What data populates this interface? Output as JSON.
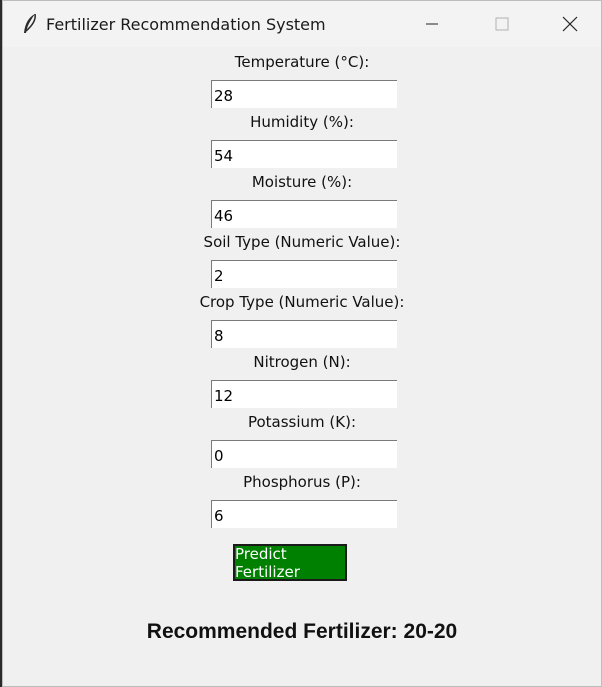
{
  "window": {
    "title": "Fertilizer Recommendation System",
    "app_icon": "feather-icon",
    "controls": [
      "minimize-icon",
      "maximize-icon",
      "close-icon"
    ]
  },
  "fields": [
    {
      "label": "Temperature (°C):",
      "value": "28"
    },
    {
      "label": "Humidity (%):",
      "value": "54"
    },
    {
      "label": "Moisture (%):",
      "value": "46"
    },
    {
      "label": "Soil Type (Numeric Value):",
      "value": "2"
    },
    {
      "label": "Crop Type (Numeric Value):",
      "value": "8"
    },
    {
      "label": "Nitrogen (N):",
      "value": "12"
    },
    {
      "label": "Potassium (K):",
      "value": "0"
    },
    {
      "label": "Phosphorus (P):",
      "value": "6"
    }
  ],
  "predict_button": {
    "label": "Predict Fertilizer",
    "color": "#008000"
  },
  "result": {
    "text": "Recommended Fertilizer: 20-20"
  }
}
